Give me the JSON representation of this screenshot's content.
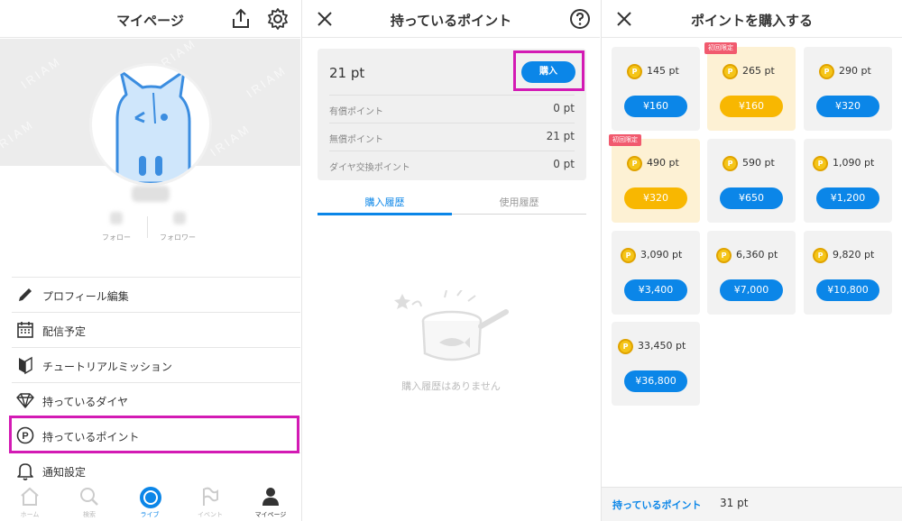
{
  "mypage": {
    "title": "マイページ",
    "follow_label": "フォロー",
    "follower_label": "フォロワー",
    "menu": [
      {
        "label": "プロフィール編集",
        "icon": "pencil-icon"
      },
      {
        "label": "配信予定",
        "icon": "calendar-icon"
      },
      {
        "label": "チュートリアルミッション",
        "icon": "beginner-mark-icon"
      },
      {
        "label": "持っているダイヤ",
        "icon": "diamond-icon"
      },
      {
        "label": "持っているポイント",
        "icon": "point-icon"
      },
      {
        "label": "通知設定",
        "icon": "bell-icon"
      }
    ],
    "nav": [
      {
        "label": "ホーム",
        "icon": "home-icon"
      },
      {
        "label": "検索",
        "icon": "search-icon"
      },
      {
        "label": "ライブ",
        "icon": "live-icon"
      },
      {
        "label": "イベント",
        "icon": "flag-icon"
      },
      {
        "label": "マイページ",
        "icon": "person-icon"
      }
    ],
    "watermark": "IRIAM"
  },
  "points": {
    "title": "持っているポイント",
    "total": "21 pt",
    "buy_label": "購入",
    "rows": [
      {
        "label": "有償ポイント",
        "value": "0 pt"
      },
      {
        "label": "無償ポイント",
        "value": "21 pt"
      },
      {
        "label": "ダイヤ交換ポイント",
        "value": "0 pt"
      }
    ],
    "tabs": [
      "購入履歴",
      "使用履歴"
    ],
    "empty_text": "購入履歴はありません"
  },
  "shop": {
    "title": "ポイントを購入する",
    "first_badge": "初回限定",
    "coin_letter": "P",
    "items": [
      {
        "pt": "145 pt",
        "price": "¥160",
        "first": false
      },
      {
        "pt": "265 pt",
        "price": "¥160",
        "first": true
      },
      {
        "pt": "290 pt",
        "price": "¥320",
        "first": false
      },
      {
        "pt": "490 pt",
        "price": "¥320",
        "first": true
      },
      {
        "pt": "590 pt",
        "price": "¥650",
        "first": false
      },
      {
        "pt": "1,090 pt",
        "price": "¥1,200",
        "first": false
      },
      {
        "pt": "3,090 pt",
        "price": "¥3,400",
        "first": false
      },
      {
        "pt": "6,360 pt",
        "price": "¥7,000",
        "first": false
      },
      {
        "pt": "9,820 pt",
        "price": "¥10,800",
        "first": false
      },
      {
        "pt": "33,450 pt",
        "price": "¥36,800",
        "first": false
      }
    ],
    "footer_label": "持っているポイント",
    "footer_value": "31 pt"
  },
  "colors": {
    "accent": "#0b86e8",
    "first_card_bg": "#fdf1d4",
    "first_price": "#f8b701",
    "highlight": "#d31ab4",
    "badge": "#f15a6e"
  }
}
